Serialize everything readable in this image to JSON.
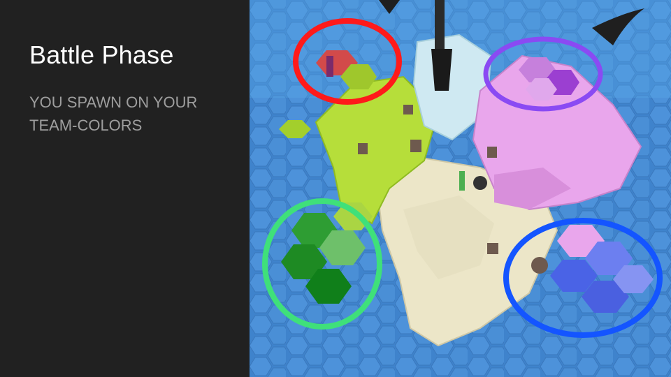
{
  "slide": {
    "title": "Battle Phase",
    "body": "YOU SPAWN ON YOUR TEAM-COLORS"
  },
  "scene": {
    "description_icon": "game-screenshot-image",
    "team_markers": [
      {
        "team": "red",
        "color": "#ff1a1a"
      },
      {
        "team": "purple",
        "color": "#8a4af3"
      },
      {
        "team": "green",
        "color": "#3fe07a"
      },
      {
        "team": "blue",
        "color": "#1455ff"
      }
    ],
    "colors": {
      "water": "#3f83cc",
      "water_light": "#5aa0e3",
      "sand": "#ece6c8",
      "grass": "#b6de3a",
      "pink": "#e9a6ec",
      "ice": "#cfe9f2",
      "team_green": "#1e9e2a",
      "team_blue": "#4a63e6",
      "team_purple": "#9b3fd1",
      "team_red": "#d24a4a"
    }
  }
}
